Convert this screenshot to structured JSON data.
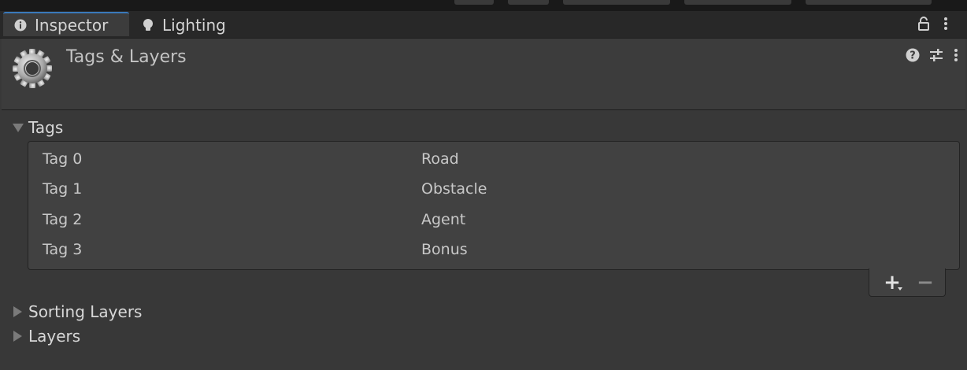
{
  "tabs": [
    {
      "label": "Inspector",
      "icon": "info-icon",
      "active": true
    },
    {
      "label": "Lighting",
      "icon": "lightbulb-icon",
      "active": false
    }
  ],
  "header": {
    "title": "Tags & Layers",
    "icon": "gear-icon",
    "actions": [
      "help-icon",
      "preset-sliders-icon",
      "kebab-menu-icon"
    ]
  },
  "tags": {
    "label": "Tags",
    "expanded": true,
    "items": [
      {
        "name": "Tag 0",
        "value": "Road"
      },
      {
        "name": "Tag 1",
        "value": "Obstacle"
      },
      {
        "name": "Tag 2",
        "value": "Agent"
      },
      {
        "name": "Tag 3",
        "value": "Bonus"
      }
    ],
    "add_label": "+",
    "remove_label": "−"
  },
  "sorting_layers": {
    "label": "Sorting Layers",
    "expanded": false
  },
  "layers": {
    "label": "Layers",
    "expanded": false
  },
  "colors": {
    "accent": "#3a79bb",
    "background": "#383838",
    "panel": "#414141"
  }
}
